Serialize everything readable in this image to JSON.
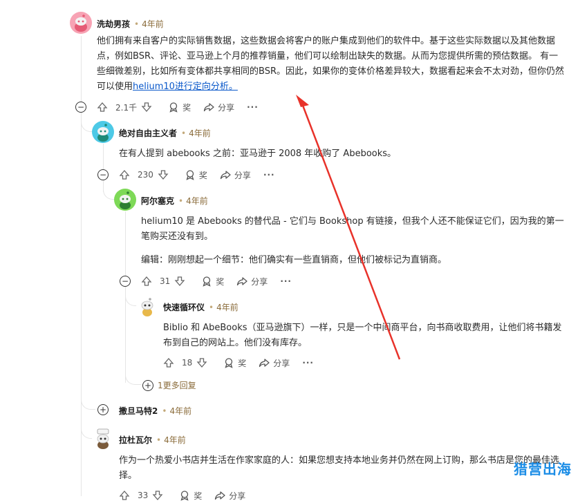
{
  "comments": [
    {
      "author": "洗劫男孩",
      "time": "4年前",
      "body_pre": "他们拥有来自客户的实际销售数据，这些数据会将客户的账户集成到他们的软件中。基于这些实际数据以及其他数据点，例如BSR、评论、亚马逊上个月的推荐销量，他们可以绘制出缺失的数据。从而为您提供所需的预估数据。 有一些细微差别，比如所有变体都共享相同的BSR。因此，如果你的变体价格差异较大，数据看起来会不太对劲，但你仍然可以使用",
      "body_link": "helium10进行定向分析。",
      "votes": "2.1千",
      "avatar_color": "#f7a3b4"
    },
    {
      "author": "绝对自由主义者",
      "time": "4年前",
      "body": "在有人提到 abebooks 之前：亚马逊于 2008 年收购了 Abebooks。",
      "votes": "230",
      "avatar_color": "#4dc9e6"
    },
    {
      "author": "阿尔塞克",
      "time": "4年前",
      "body": "helium10 是 Abebooks 的替代品 - 它们与 Bookshop 有链接，但我个人还不能保证它们，因为我的第一笔购买还没有到。",
      "body2": "编辑：刚刚想起一个细节：他们确实有一些直销商，但他们被标记为直销商。",
      "votes": "31",
      "avatar_color": "#7ed957"
    },
    {
      "author": "快速循环仪",
      "time": "4年前",
      "body": "Biblio 和 AbeBooks（亚马逊旗下）一样，只是一个中间商平台，向书商收取费用，让他们将书籍发布到自己的网站上。他们没有库存。",
      "votes": "18",
      "avatar_color": "#e8e8e8"
    },
    {
      "author": "撒旦马特2",
      "time": "4年前"
    },
    {
      "author": "拉杜瓦尔",
      "time": "4年前",
      "body": "作为一个热爱小书店并生活在作家家庭的人：如果您想支持本地业务并仍然在网上订购，那么书店是您的最佳选择。",
      "votes": "33"
    }
  ],
  "labels": {
    "award": "奖",
    "share": "分享",
    "more": "···",
    "more_replies": "1更多回复"
  },
  "watermark": "猎营出海"
}
